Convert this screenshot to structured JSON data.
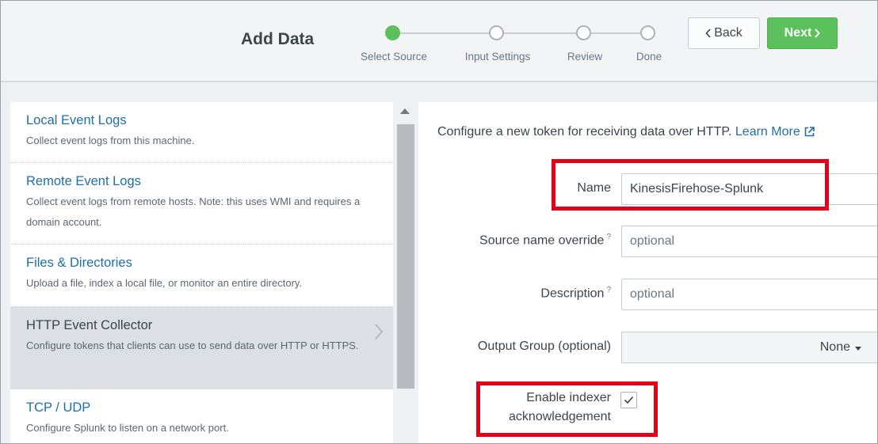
{
  "header": {
    "title": "Add Data",
    "steps": [
      {
        "label": "Select Source",
        "state": "complete"
      },
      {
        "label": "Input Settings",
        "state": "pending"
      },
      {
        "label": "Review",
        "state": "pending"
      },
      {
        "label": "Done",
        "state": "pending"
      }
    ],
    "back_label": "Back",
    "next_label": "Next",
    "back_icon": "chevron-left-icon",
    "next_icon": "chevron-right-icon",
    "accent_color": "#5cc05c"
  },
  "sources": [
    {
      "title": "Local Event Logs",
      "description": "Collect event logs from this machine."
    },
    {
      "title": "Remote Event Logs",
      "description": "Collect event logs from remote hosts. Note: this uses WMI and requires a domain account."
    },
    {
      "title": "Files & Directories",
      "description": "Upload a file, index a local file, or monitor an entire directory."
    },
    {
      "title": "HTTP Event Collector",
      "description": "Configure tokens that clients can use to send data over HTTP or HTTPS.",
      "selected": true
    },
    {
      "title": "TCP / UDP",
      "description": "Configure Splunk to listen on a network port."
    }
  ],
  "form": {
    "intro_text": "Configure a new token for receiving data over HTTP.",
    "learn_more": "Learn More",
    "name_label": "Name",
    "name_value": "KinesisFirehose-Splunk",
    "source_label": "Source name override",
    "source_placeholder": "optional",
    "description_label": "Description",
    "description_placeholder": "optional",
    "help_mark": "?",
    "output_group_label": "Output Group (optional)",
    "output_group_value": "None",
    "ack_label_line1": "Enable indexer",
    "ack_label_line2": "acknowledgement",
    "ack_checked": true,
    "highlight_color": "#e3001b"
  }
}
